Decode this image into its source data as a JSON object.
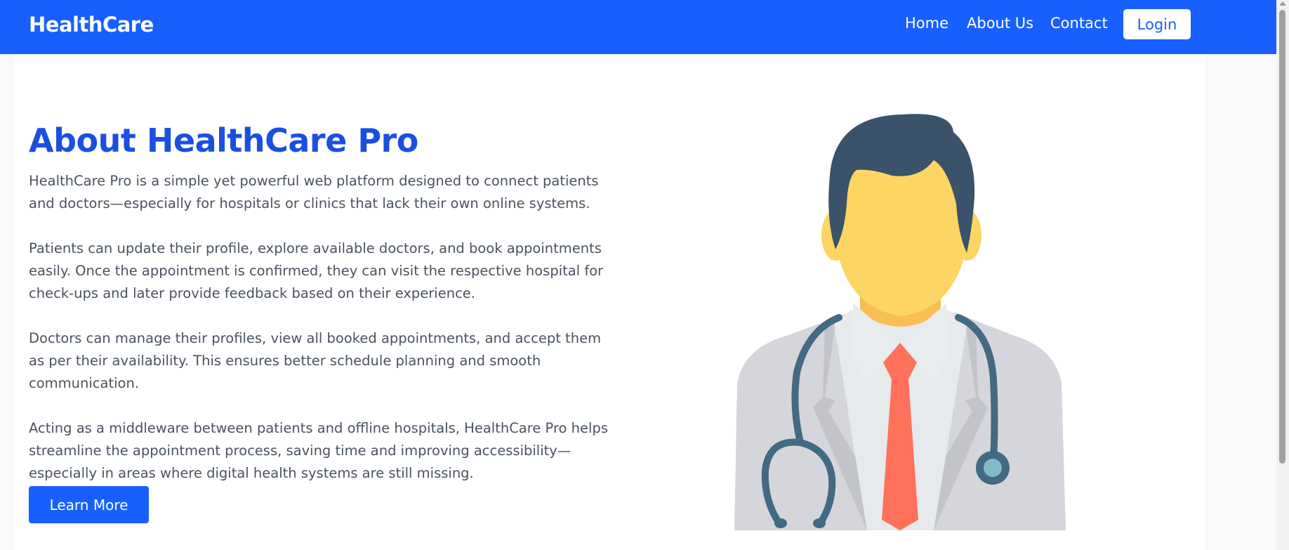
{
  "navbar": {
    "brand": "HealthCare",
    "links": [
      "Home",
      "About Us",
      "Contact"
    ],
    "login_label": "Login"
  },
  "main": {
    "title": "About HealthCare Pro",
    "paragraphs": [
      "HealthCare Pro is a simple yet powerful web platform designed to connect patients and doctors—especially for hospitals or clinics that lack their own online systems.",
      "Patients can update their profile, explore available doctors, and book appointments easily. Once the appointment is confirmed, they can visit the respective hospital for check-ups and later provide feedback based on their experience.",
      "Doctors can manage their profiles, view all booked appointments, and accept them as per their availability. This ensures better schedule planning and smooth communication.",
      "Acting as a middleware between patients and offline hospitals, HealthCare Pro helps streamline the appointment process, saving time and improving accessibility—especially in areas where digital health systems are still missing."
    ],
    "learn_more_label": "Learn More"
  },
  "illustration": {
    "icon": "doctor-illustration-icon"
  },
  "colors": {
    "primary": "#1760ff",
    "title": "#1a4fe0",
    "text": "#495260",
    "hair": "#3a536b",
    "skin": "#fdd562",
    "coat": "#d5d6db",
    "tie": "#ff715a",
    "stethoscope": "#426a82"
  }
}
